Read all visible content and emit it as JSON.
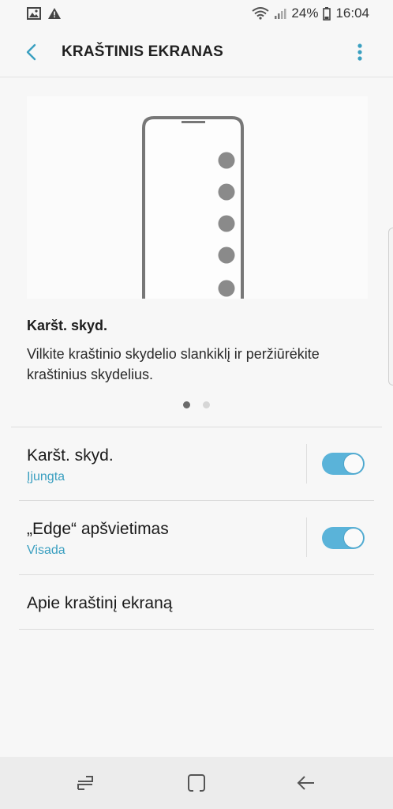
{
  "status_bar": {
    "battery_percent": "24%",
    "time": "16:04",
    "icons_left": [
      "image-icon",
      "warning-icon"
    ],
    "icons_right": [
      "wifi-icon",
      "signal-icon",
      "battery-icon"
    ]
  },
  "app_bar": {
    "title": "KRAŠTINIS EKRANAS",
    "back_icon": "chevron-left-icon",
    "more_icon": "more-vert-icon",
    "accent": "#3a9fc0"
  },
  "intro": {
    "title": "Karšt. skyd.",
    "description": "Vilkite kraštinio skydelio slankiklį ir peržiūrėkite kraštinius skydelius.",
    "page_count": 2,
    "active_page": 1
  },
  "settings": [
    {
      "title": "Karšt. skyd.",
      "subtitle": "Įjungta",
      "toggle_on": true
    },
    {
      "title": "„Edge“ apšvietimas",
      "subtitle": "Visada",
      "toggle_on": true
    },
    {
      "title": "Apie kraštinį ekraną"
    }
  ],
  "nav_bar": {
    "recents_icon": "recents-icon",
    "home_icon": "home-icon",
    "back_icon": "back-arrow-icon"
  },
  "colors": {
    "toggle_on": "#5ab3d9",
    "subtitle": "#3a9fc0",
    "background": "#f7f7f7"
  }
}
